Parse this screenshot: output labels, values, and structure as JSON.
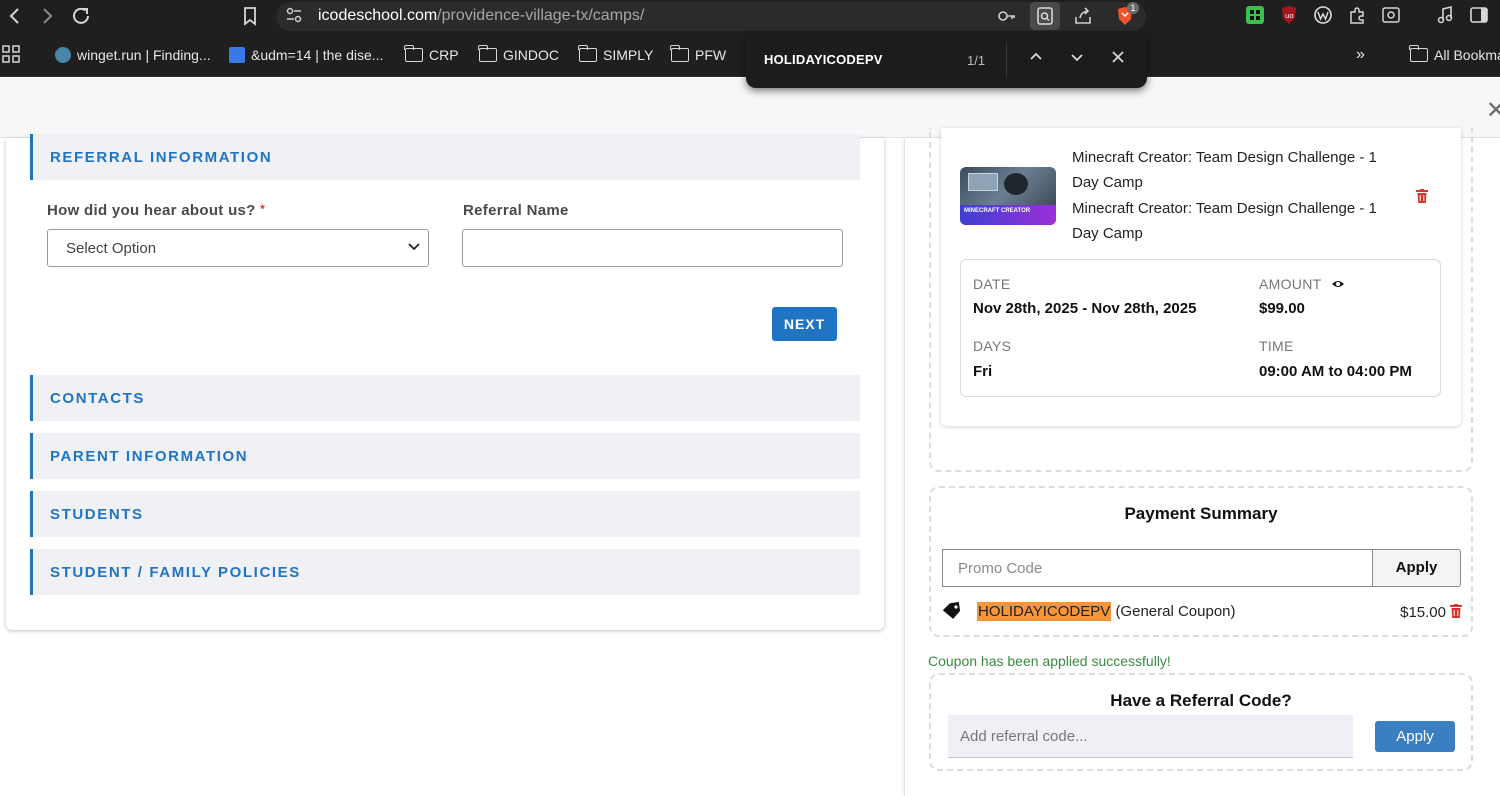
{
  "browser": {
    "url_host": "icodeschool.com",
    "url_path": "/providence-village-tx/camps/",
    "extension_badge": "1",
    "bookmarks": [
      {
        "label": "winget.run | Finding...",
        "type": "site"
      },
      {
        "label": "&udm=14 | the dise...",
        "type": "site"
      },
      {
        "label": "CRP",
        "type": "folder"
      },
      {
        "label": "GINDOC",
        "type": "folder"
      },
      {
        "label": "SIMPLY",
        "type": "folder"
      },
      {
        "label": "PFW",
        "type": "folder"
      }
    ],
    "bookmarks_overflow": "»",
    "all_bookmarks": "All Bookma",
    "find": {
      "query": "HOLIDAYICODEPV",
      "count": "1/1"
    }
  },
  "form": {
    "sections": {
      "referral": "REFERRAL INFORMATION",
      "contacts": "CONTACTS",
      "parent": "PARENT INFORMATION",
      "students": "STUDENTS",
      "policies": "STUDENT / FAMILY POLICIES"
    },
    "hear_label": "How did you hear about us?",
    "required_mark": "*",
    "hear_value": "Select Option",
    "referral_name_label": "Referral Name",
    "referral_name_value": "",
    "next_label": "NEXT"
  },
  "cart": {
    "thumb_caption": "MINECRAFT CREATOR",
    "item_title": "Minecraft Creator: Team Design Challenge - 1 Day Camp",
    "item_subtitle": "Minecraft Creator: Team Design Challenge - 1 Day Camp",
    "date_label": "DATE",
    "date_value": "Nov 28th, 2025 - Nov 28th, 2025",
    "amount_label": "AMOUNT",
    "amount_value": "$99.00",
    "days_label": "DAYS",
    "days_value": "Fri",
    "time_label": "TIME",
    "time_value": "09:00 AM to 04:00 PM"
  },
  "payment": {
    "title": "Payment Summary",
    "promo_placeholder": "Promo Code",
    "apply_label": "Apply",
    "coupon_code": "HOLIDAYICODEPV",
    "coupon_type": "(General Coupon)",
    "coupon_amount": "$15.00",
    "success_message": "Coupon has been applied successfully!"
  },
  "referral_code": {
    "title": "Have a Referral Code?",
    "placeholder": "Add referral code...",
    "apply_label": "Apply"
  },
  "colors": {
    "accent": "#1f74c4",
    "highlight": "#f6953a",
    "success": "#3b8a43",
    "danger": "#d9342b"
  }
}
